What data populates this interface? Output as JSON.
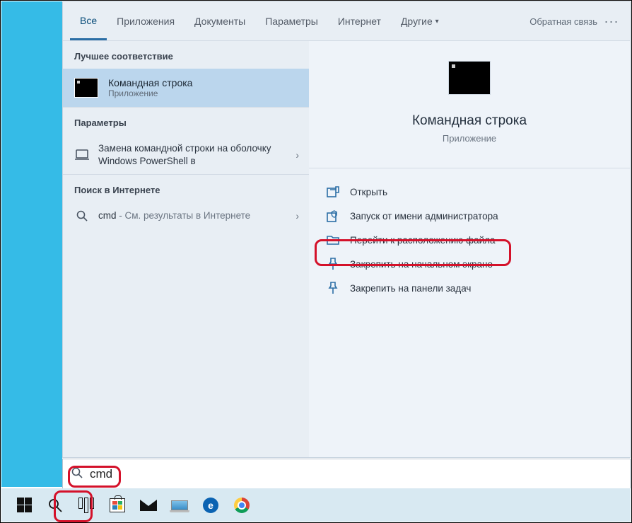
{
  "tabs": {
    "items": [
      "Все",
      "Приложения",
      "Документы",
      "Параметры",
      "Интернет",
      "Другие"
    ],
    "activeIndex": 0,
    "feedback": "Обратная связь"
  },
  "left": {
    "bestMatchHeader": "Лучшее соответствие",
    "bestMatch": {
      "title": "Командная строка",
      "subtitle": "Приложение"
    },
    "paramsHeader": "Параметры",
    "paramRow": "Замена командной строки на оболочку Windows PowerShell в",
    "webHeader": "Поиск в Интернете",
    "webRow": {
      "query": "cmd",
      "suffix": " - См. результаты в Интернете"
    }
  },
  "preview": {
    "title": "Командная строка",
    "subtitle": "Приложение",
    "actions": [
      "Открыть",
      "Запуск от имени администратора",
      "Перейти к расположению файла",
      "Закрепить на начальном экране",
      "Закрепить на панели задач"
    ]
  },
  "search": {
    "value": "cmd"
  }
}
